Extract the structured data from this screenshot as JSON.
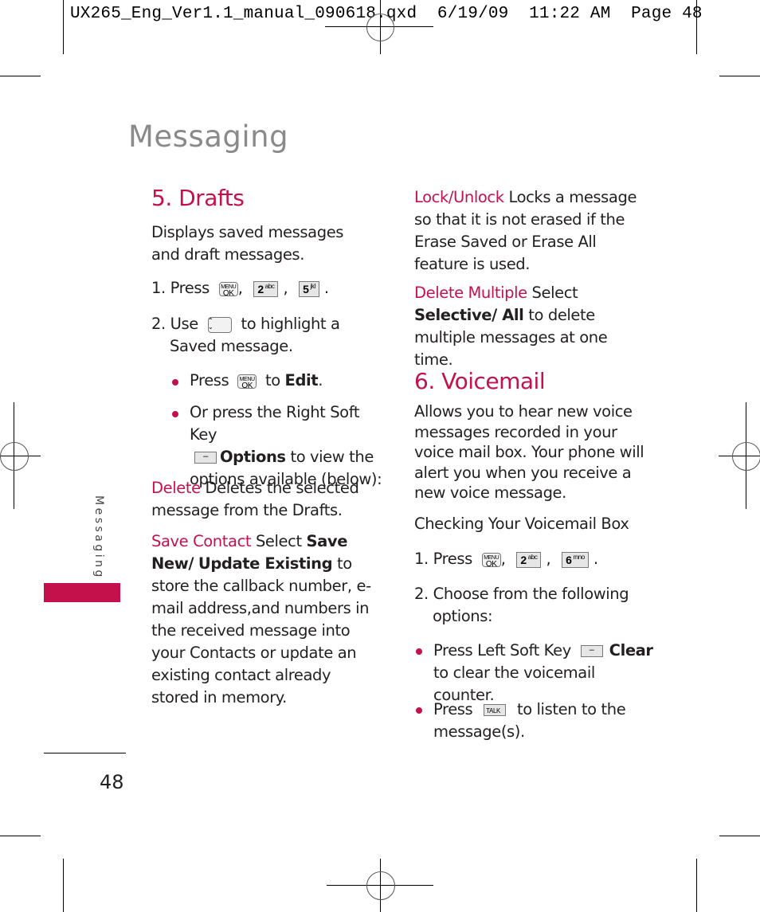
{
  "slug": {
    "text": "UX265_Eng_Ver1.1_manual_090618.qxd  6/19/09  11:22 AM  Page 48"
  },
  "page": {
    "title": "Messaging",
    "side_tab_label": "Messaging",
    "page_number": "48",
    "accent_color": "#c4114b"
  },
  "drafts": {
    "heading": "5. Drafts",
    "intro": "Displays saved messages and draft messages.",
    "step1": {
      "prefix": "1. Press",
      "keys": [
        "MENU OK",
        "2 abc",
        "5 jkl"
      ],
      "sep": ",",
      "end": "."
    },
    "step2": {
      "prefix": "2. Use",
      "key": "navigation-up-down",
      "text": "to highlight a Saved message."
    },
    "bullet1": {
      "prefix": "Press",
      "key": "MENU OK",
      "mid": "to",
      "bold": "Edit",
      "end": "."
    },
    "bullet2": {
      "text1": "Or press the Right Soft Key",
      "bold": "Options",
      "text2": "to view the options available (below):"
    },
    "options": [
      {
        "term": "Delete",
        "desc": "Deletes the selected message from the Drafts."
      },
      {
        "term": "Save Contact",
        "desc_pre": "Select",
        "bold1": "Save New/",
        "bold2": "Update Existing",
        "desc": "to store the callback number, e-mail address,and numbers in the received message into your Contacts or update an existing contact already stored in memory."
      },
      {
        "term": "Lock/Unlock",
        "desc": "Locks a message so that it is not erased if the Erase Saved or Erase All feature is used."
      },
      {
        "term": "Delete Multiple",
        "desc_pre": "Select",
        "bold1": "Selective/ All",
        "desc": "to delete multiple messages at one time."
      }
    ]
  },
  "voicemail": {
    "heading": "6. Voicemail",
    "intro": "Allows you to hear new voice messages recorded in your voice mail box. Your phone will alert you when you receive a new voice message.",
    "subheading": "Checking Your Voicemail Box",
    "step1": {
      "prefix": "1. Press",
      "keys": [
        "MENU OK",
        "2 abc",
        "6 mno"
      ],
      "sep": ",",
      "end": "."
    },
    "step2": "2. Choose from the following options:",
    "bullet1": {
      "prefix": "Press Left Soft Key",
      "bold": "Clear",
      "text": "to clear the voicemail counter."
    },
    "bullet2": {
      "prefix": "Press",
      "key": "TALK",
      "text": "to listen to the message(s)."
    }
  },
  "keys": {
    "menu_top": "MENU",
    "menu_bottom": "OK",
    "k2": "2",
    "k2_sub": "abc",
    "k5": "5",
    "k5_sub": "jkl",
    "k6": "6",
    "k6_sub": "mno",
    "talk": "TALK",
    "soft_glyph": "–",
    "nav_up": "⌃",
    "nav_down": "⌄"
  }
}
